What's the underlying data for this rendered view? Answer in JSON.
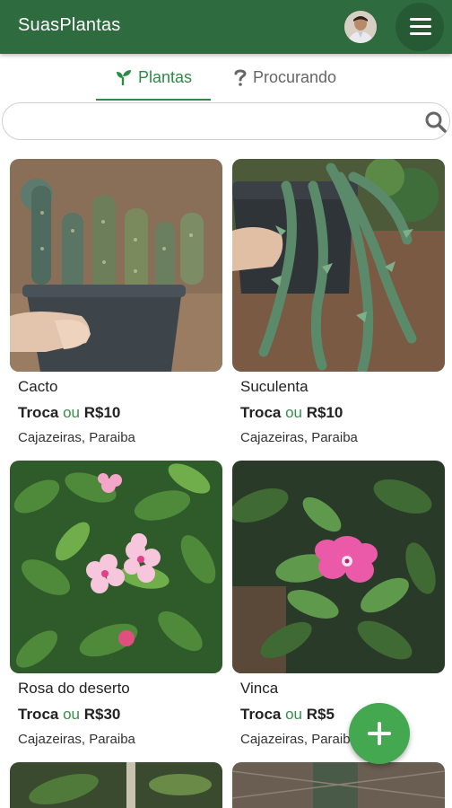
{
  "app": {
    "title": "SuasPlantas",
    "brand_color": "#2e6b3f",
    "accent_color": "#2e8a44",
    "avatar_icon": "user-avatar",
    "menu_icon": "hamburger-menu-icon"
  },
  "tabs": [
    {
      "label": "Plantas",
      "icon": "sprout-icon",
      "selected": true
    },
    {
      "label": "Procurando",
      "icon": "question-mark-icon",
      "selected": false
    }
  ],
  "search": {
    "value": "",
    "placeholder": "",
    "icon": "search-icon"
  },
  "plants": [
    {
      "name": "Cacto",
      "trade": "Troca",
      "or": "ou",
      "price": "R$10",
      "location": "Cajazeiras, Paraiba"
    },
    {
      "name": "Suculenta",
      "trade": "Troca",
      "or": "ou",
      "price": "R$10",
      "location": "Cajazeiras, Paraiba"
    },
    {
      "name": "Rosa do deserto",
      "trade": "Troca",
      "or": "ou",
      "price": "R$30",
      "location": "Cajazeiras, Paraiba"
    },
    {
      "name": "Vinca",
      "trade": "Troca",
      "or": "ou",
      "price": "R$5",
      "location": "Cajazeiras, Paraiba"
    }
  ],
  "fab": {
    "icon": "plus-icon"
  }
}
